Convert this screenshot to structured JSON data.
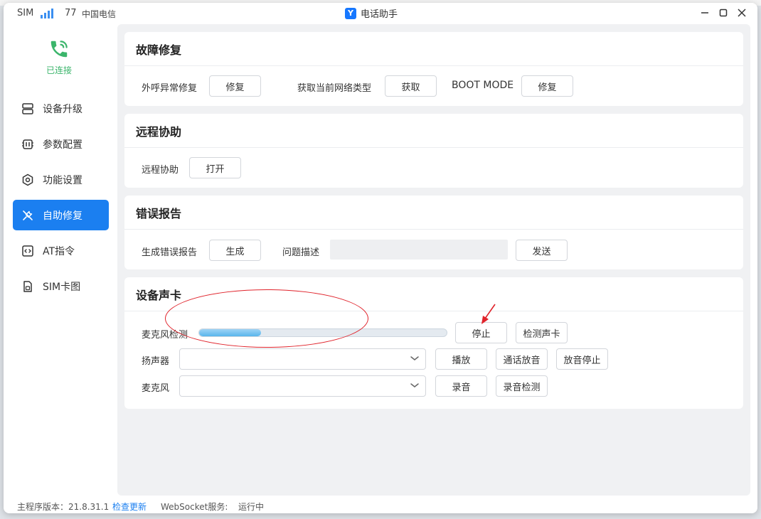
{
  "titlebar": {
    "sim_label": "SIM",
    "signal_value": "77",
    "carrier": "中国电信",
    "app_title": "电话助手"
  },
  "sidebar": {
    "connection_status": "已连接",
    "items": [
      {
        "label": "设备升级",
        "icon": "device-upgrade-icon",
        "active": false
      },
      {
        "label": "参数配置",
        "icon": "chip-icon",
        "active": false
      },
      {
        "label": "功能设置",
        "icon": "gear-icon",
        "active": false
      },
      {
        "label": "自助修复",
        "icon": "tools-icon",
        "active": true
      },
      {
        "label": "AT指令",
        "icon": "code-icon",
        "active": false
      },
      {
        "label": "SIM卡图",
        "icon": "sim-card-icon",
        "active": false
      }
    ]
  },
  "cards": {
    "fault_repair": {
      "title": "故障修复",
      "outbound_label": "外呼异常修复",
      "outbound_btn": "修复",
      "network_label": "获取当前网络类型",
      "network_btn": "获取",
      "boot_label": "BOOT MODE",
      "boot_btn": "修复"
    },
    "remote": {
      "title": "远程协助",
      "label": "远程协助",
      "btn": "打开"
    },
    "error_report": {
      "title": "错误报告",
      "generate_label": "生成错误报告",
      "generate_btn": "生成",
      "desc_label": "问题描述",
      "desc_value": "",
      "send_btn": "发送"
    },
    "sound_card": {
      "title": "设备声卡",
      "mic_test_label": "麦克风检测",
      "mic_level": 0.25,
      "stop_btn": "停止",
      "detect_btn": "检测声卡",
      "speaker_label": "扬声器",
      "speaker_value": "",
      "play_btn": "播放",
      "call_play_btn": "通话放音",
      "stop_play_btn": "放音停止",
      "mic_label": "麦克风",
      "mic_value": "",
      "record_btn": "录音",
      "record_check_btn": "录音检测"
    }
  },
  "footer": {
    "version_label": "主程序版本：21.8.31.1",
    "check_update": "检查更新",
    "websocket_label": "WebSocket服务:",
    "websocket_status": "运行中"
  },
  "colors": {
    "accent": "#1b7ff0",
    "connected": "#3bb56b",
    "annotation": "#e0232b"
  }
}
